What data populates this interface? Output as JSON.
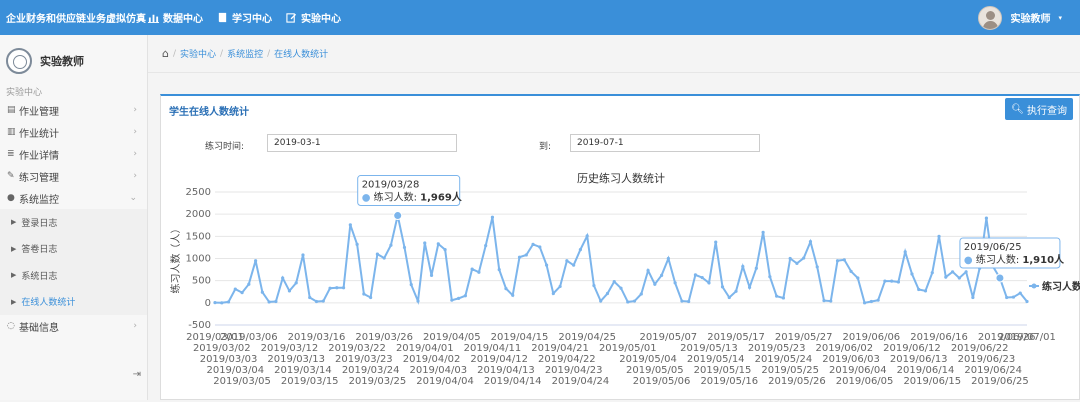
{
  "topbar": {
    "brand": "企业财务和供应链业务虚拟仿真",
    "nav": [
      {
        "icon": "bar-chart-icon",
        "label": "数据中心"
      },
      {
        "icon": "book-icon",
        "label": "学习中心"
      },
      {
        "icon": "edit-icon",
        "label": "实验中心"
      }
    ],
    "user_name": "实验教师"
  },
  "sidebar": {
    "profile_name": "实验教师",
    "section_label": "实验中心",
    "items": [
      {
        "label": "作业管理",
        "icon": "document-icon"
      },
      {
        "label": "作业统计",
        "icon": "bar-chart-icon"
      },
      {
        "label": "作业详情",
        "icon": "list-icon"
      },
      {
        "label": "练习管理",
        "icon": "edit-icon"
      },
      {
        "label": "系统监控",
        "icon": "info-icon"
      }
    ],
    "subitems": [
      {
        "label": "登录日志"
      },
      {
        "label": "答卷日志"
      },
      {
        "label": "系统日志"
      },
      {
        "label": "在线人数统计"
      }
    ],
    "last_item": {
      "label": "基础信息",
      "icon": "comment-icon"
    }
  },
  "breadcrumb": [
    "实验中心",
    "系统监控",
    "在线人数统计"
  ],
  "panel": {
    "title": "学生在线人数统计",
    "exec_label": "执行查询",
    "from_label": "练习时间:",
    "from_value": "2019-03-1",
    "to_label": "到:",
    "to_value": "2019-07-1"
  },
  "chart_data": {
    "type": "line",
    "title": "历史练习人数统计",
    "ylabel": "练习人数（人）",
    "ylim": [
      -500,
      2500
    ],
    "yticks": [
      2500,
      2000,
      1500,
      1000,
      500,
      0,
      -500
    ],
    "legend": "right",
    "grid": true,
    "color": "#7cb5ec",
    "series": [
      {
        "name": "练习人数",
        "x_start": "2019-03-01",
        "x_end": "2019-07-01",
        "values": [
          5,
          0,
          20,
          310,
          230,
          420,
          950,
          240,
          20,
          30,
          560,
          270,
          450,
          1080,
          120,
          30,
          40,
          330,
          340,
          340,
          1760,
          1320,
          200,
          120,
          1100,
          1010,
          1300,
          1969,
          1250,
          410,
          40,
          1350,
          620,
          1330,
          1200,
          60,
          100,
          160,
          760,
          690,
          1290,
          1930,
          750,
          320,
          170,
          1030,
          1080,
          1320,
          1260,
          850,
          210,
          370,
          950,
          850,
          1200,
          1510,
          390,
          40,
          210,
          480,
          330,
          20,
          40,
          200,
          730,
          420,
          620,
          1000,
          450,
          40,
          30,
          630,
          570,
          450,
          1370,
          360,
          120,
          260,
          820,
          350,
          780,
          1590,
          590,
          150,
          110,
          1000,
          890,
          1010,
          1380,
          810,
          50,
          40,
          950,
          970,
          710,
          560,
          0,
          30,
          60,
          490,
          490,
          470,
          1150,
          650,
          300,
          270,
          680,
          1500,
          580,
          700,
          560,
          700,
          120,
          780,
          1910,
          810,
          560,
          120,
          130,
          220,
          30
        ]
      }
    ],
    "x_tick_labels_row1": [
      "2019/03/01",
      "2019/03/06",
      "2019/03/16",
      "2019/03/26",
      "2019/04/05",
      "2019/04/15",
      "2019/04/25",
      "2019/05/07",
      "2019/05/17",
      "2019/05/27",
      "2019/06/06",
      "2019/06/16",
      "2019/06/26",
      "2019/07/01"
    ],
    "x_tick_labels_row2": [
      "2019/03/02",
      "2019/03/12",
      "2019/03/22",
      "2019/04/01",
      "2019/04/11",
      "2019/04/21",
      "2019/05/01",
      "2019/05/13",
      "2019/05/23",
      "2019/06/02",
      "2019/06/12",
      "2019/06/22"
    ],
    "x_tick_labels_row3": [
      "2019/03/03",
      "2019/03/13",
      "2019/03/23",
      "2019/04/02",
      "2019/04/12",
      "2019/04/22",
      "2019/05/04",
      "2019/05/14",
      "2019/05/24",
      "2019/06/03",
      "2019/06/13",
      "2019/06/23"
    ],
    "x_tick_labels_row4": [
      "2019/03/04",
      "2019/03/14",
      "2019/03/24",
      "2019/04/03",
      "2019/04/13",
      "2019/04/23",
      "2019/05/05",
      "2019/05/15",
      "2019/05/25",
      "2019/06/04",
      "2019/06/14",
      "2019/06/24"
    ],
    "x_tick_labels_row5": [
      "2019/03/05",
      "2019/03/15",
      "2019/03/25",
      "2019/04/04",
      "2019/04/14",
      "2019/04/24",
      "2019/05/06",
      "2019/05/16",
      "2019/05/26",
      "2019/06/05",
      "2019/06/15",
      "2019/06/25"
    ],
    "tooltips": [
      {
        "date": "2019/03/28",
        "label": "练习人数",
        "value": "1,969人"
      },
      {
        "date": "2019/06/25",
        "label": "练习人数",
        "value": "1,910人"
      }
    ]
  }
}
